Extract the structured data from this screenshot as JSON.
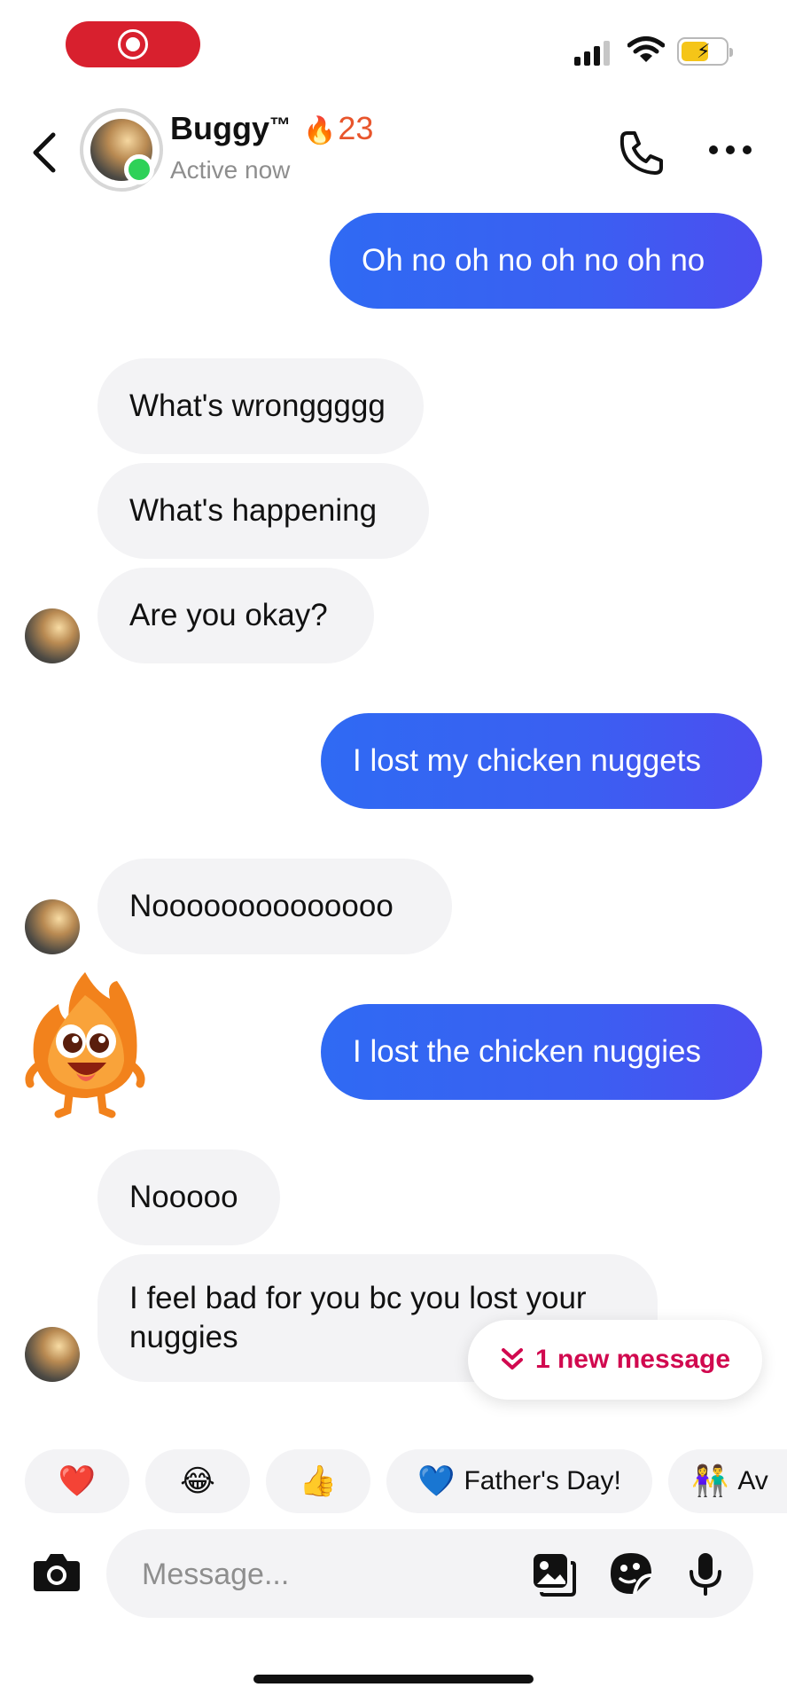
{
  "status_bar": {
    "recording_icon": "screen-record-icon",
    "signal_icon": "cellular-signal-icon",
    "wifi_icon": "wifi-icon",
    "battery_icon": "battery-charging-icon",
    "battery_level": 0.55
  },
  "header": {
    "name": "Buggy",
    "trademark": "™",
    "streak_icon": "🔥",
    "streak_count": "23",
    "status": "Active now",
    "icons": [
      "back-chevron-icon",
      "phone-icon",
      "more-icon"
    ]
  },
  "messages": [
    {
      "from": "me",
      "text": "Oh no oh no oh no oh no"
    },
    {
      "from": "them",
      "text": "What's wronggggg"
    },
    {
      "from": "them",
      "text": "What's happening"
    },
    {
      "from": "them",
      "text": "Are you okay?"
    },
    {
      "from": "me",
      "text": "I lost my chicken nuggets"
    },
    {
      "from": "them",
      "text": "Noooooooooooooo"
    },
    {
      "from": "me",
      "text": "I lost the chicken nuggies"
    },
    {
      "from": "them",
      "text": "Nooooo"
    },
    {
      "from": "them",
      "text": "I feel bad for you bc you lost your nuggies"
    }
  ],
  "new_message_pill": {
    "icon": "double-chevron-down-icon",
    "label": "1 new message"
  },
  "quick_replies": [
    {
      "emoji": "❤️",
      "label": ""
    },
    {
      "emoji": "😂",
      "label": ""
    },
    {
      "emoji": "👍",
      "label": ""
    },
    {
      "emoji": "💙",
      "label": "Father's Day!"
    },
    {
      "emoji": "👫",
      "label": "Av"
    }
  ],
  "composer": {
    "placeholder": "Message...",
    "icons": [
      "camera-icon",
      "gallery-icon",
      "sticker-icon",
      "microphone-icon"
    ]
  },
  "colors": {
    "outgoing_bubble": "#3b5ff2",
    "incoming_bubble": "#f3f3f5",
    "online": "#2ed158",
    "accent": "#d1094f"
  }
}
